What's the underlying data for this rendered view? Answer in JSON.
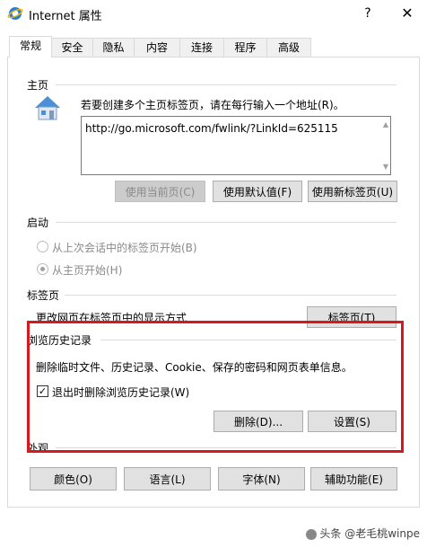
{
  "window": {
    "title": "Internet 属性",
    "help": "?",
    "close": "✕"
  },
  "tabs": [
    {
      "label": "常规",
      "active": true
    },
    {
      "label": "安全"
    },
    {
      "label": "隐私"
    },
    {
      "label": "内容"
    },
    {
      "label": "连接"
    },
    {
      "label": "程序"
    },
    {
      "label": "高级"
    }
  ],
  "homepage": {
    "section_label": "主页",
    "instruction": "若要创建多个主页标签页，请在每行输入一个地址(R)。",
    "url": "http://go.microsoft.com/fwlink/?LinkId=625115",
    "buttons": {
      "use_current": "使用当前页(C)",
      "use_default": "使用默认值(F)",
      "use_new_tab": "使用新标签页(U)"
    }
  },
  "startup": {
    "section_label": "启动",
    "option_last_session": "从上次会话中的标签页开始(B)",
    "option_homepage": "从主页开始(H)",
    "selected": "option_homepage"
  },
  "tabs_section": {
    "section_label": "标签页",
    "description": "更改网页在标签页中的显示方式",
    "button": "标签页(T)"
  },
  "history": {
    "section_label": "浏览历史记录",
    "description": "删除临时文件、历史记录、Cookie、保存的密码和网页表单信息。",
    "checkbox_label": "退出时删除浏览历史记录(W)",
    "checkbox_checked": true,
    "delete_button": "删除(D)...",
    "settings_button": "设置(S)"
  },
  "appearance": {
    "section_label": "外观",
    "colors_button": "颜色(O)",
    "languages_button": "语言(L)",
    "fonts_button": "字体(N)",
    "accessibility_button": "辅助功能(E)"
  },
  "watermark": "头条 @老毛桃winpe",
  "colors": {
    "highlight": "#d7191b"
  }
}
